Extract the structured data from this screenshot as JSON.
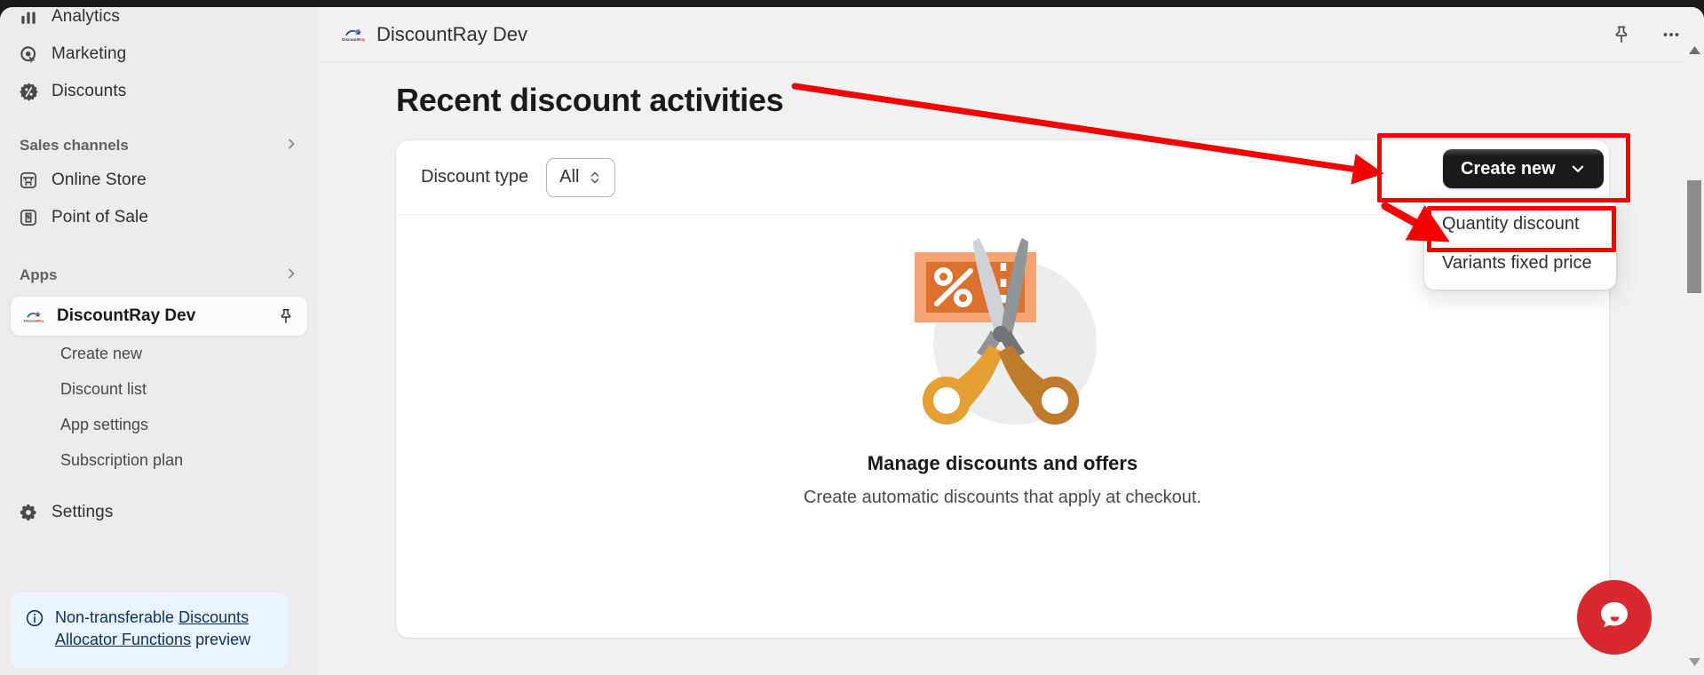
{
  "sidebar": {
    "nav_items": [
      {
        "label": "Analytics",
        "icon": "analytics-icon"
      },
      {
        "label": "Marketing",
        "icon": "marketing-icon"
      },
      {
        "label": "Discounts",
        "icon": "discount-badge-icon"
      }
    ],
    "sections": [
      {
        "label": "Sales channels",
        "expand_icon": "chevron-right-icon"
      },
      {
        "label": "Apps",
        "expand_icon": "chevron-right-icon"
      }
    ],
    "sales_channels": [
      {
        "label": "Online Store",
        "icon": "storefront-icon"
      },
      {
        "label": "Point of Sale",
        "icon": "pos-bag-icon"
      }
    ],
    "app": {
      "label": "DiscountRay Dev",
      "logo_text": "DiscountRay",
      "pin_icon": "pin-icon"
    },
    "app_sub_items": [
      {
        "label": "Create new"
      },
      {
        "label": "Discount list"
      },
      {
        "label": "App settings"
      },
      {
        "label": "Subscription plan"
      }
    ],
    "settings": {
      "label": "Settings",
      "icon": "gear-icon"
    },
    "banner": {
      "icon": "info-circle-icon",
      "text_before": "Non-transferable ",
      "link_text": "Discounts Allocator Functions",
      "text_after": " preview",
      "bg_color": "#eaf4fe",
      "text_color": "#103262"
    }
  },
  "topbar": {
    "title": "DiscountRay Dev",
    "logo_text": "DiscountRay",
    "pin_icon": "pin-icon",
    "more_icon": "more-horizontal-icon"
  },
  "page": {
    "title": "Recent discount activities"
  },
  "card": {
    "filter": {
      "label": "Discount type",
      "select_value": "All",
      "select_icon": "up-down-chevrons-icon"
    },
    "empty_state": {
      "illustration": "coupon-scissors-illustration",
      "title": "Manage discounts and offers",
      "subtitle": "Create automatic discounts that apply at checkout."
    }
  },
  "create_new": {
    "button_label": "Create new",
    "button_icon": "chevron-down-icon",
    "menu_items": [
      {
        "label": "Quantity discount"
      },
      {
        "label": "Variants fixed price"
      }
    ]
  },
  "chat": {
    "icon": "chat-bubble-icon",
    "color": "#d8282f"
  },
  "scrollbar": {
    "up_icon": "caret-up-icon",
    "down_icon": "caret-down-icon"
  },
  "annotations": {
    "highlight_color": "#f50000",
    "boxes": [
      "create-new-button",
      "quantity-discount-menu-item"
    ],
    "arrows": [
      "title-to-create-new-button",
      "create-new-to-quantity-discount"
    ]
  }
}
